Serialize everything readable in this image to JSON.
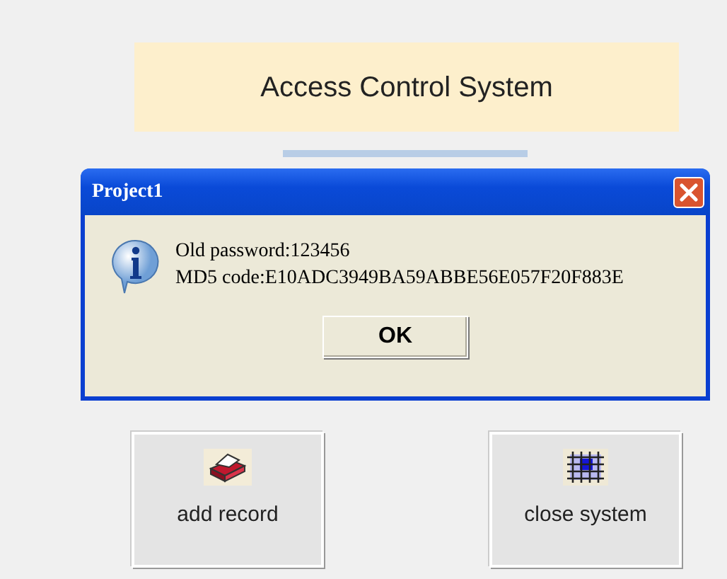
{
  "header": {
    "title": "Access Control System"
  },
  "dialog": {
    "title": "Project1",
    "kind": "info",
    "lines": [
      "Old password:123456",
      "MD5 code:E10ADC3949BA59ABBE56E057F20F883E"
    ],
    "button": "OK"
  },
  "buttons": [
    {
      "label": "add record",
      "kind": "record"
    },
    {
      "label": "close system",
      "kind": "close"
    }
  ]
}
